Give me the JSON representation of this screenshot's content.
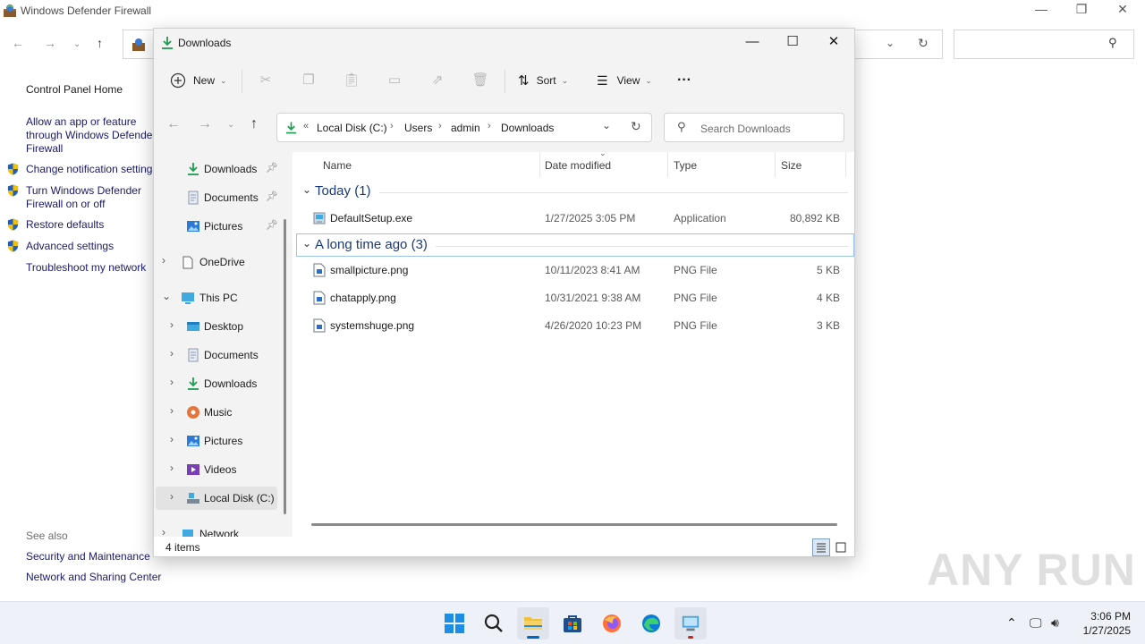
{
  "firewall": {
    "title": "Windows Defender Firewall",
    "minimize": "—",
    "maximize": "❐",
    "close": "✕",
    "sidebar": {
      "home": "Control Panel Home",
      "allow_app_line1": "Allow an app or feature",
      "allow_app_line2": "through Windows Defender",
      "allow_app_line3": "Firewall",
      "change_notification": "Change notification settings",
      "turn_on_off_line1": "Turn Windows Defender",
      "turn_on_off_line2": "Firewall on or off",
      "restore_defaults": "Restore defaults",
      "advanced_settings": "Advanced settings",
      "troubleshoot": "Troubleshoot my network"
    },
    "see_also": {
      "heading": "See also",
      "security_maintenance": "Security and Maintenance",
      "network_sharing": "Network and Sharing Center"
    }
  },
  "explorer": {
    "title": "Downloads",
    "toolbar": {
      "new_label": "New",
      "sort_label": "Sort",
      "view_label": "View",
      "more_label": "···"
    },
    "breadcrumb": {
      "overflow": "«",
      "items": [
        "Local Disk (C:)",
        "Users",
        "admin",
        "Downloads"
      ]
    },
    "search_placeholder": "Search Downloads",
    "nav": {
      "quick": [
        {
          "label": "Downloads",
          "pinned": true
        },
        {
          "label": "Documents",
          "pinned": true
        },
        {
          "label": "Pictures",
          "pinned": true
        }
      ],
      "onedrive": "OneDrive",
      "this_pc": "This PC",
      "pc_items": [
        "Desktop",
        "Documents",
        "Downloads",
        "Music",
        "Pictures",
        "Videos",
        "Local Disk (C:)"
      ],
      "network": "Network"
    },
    "columns": {
      "name": "Name",
      "date": "Date modified",
      "type": "Type",
      "size": "Size"
    },
    "groups": [
      {
        "label": "Today (1)",
        "files": [
          {
            "name": "DefaultSetup.exe",
            "date": "1/27/2025 3:05 PM",
            "type": "Application",
            "size": "80,892 KB",
            "kind": "exe"
          }
        ]
      },
      {
        "label": "A long time ago (3)",
        "files": [
          {
            "name": "smallpicture.png",
            "date": "10/11/2023 8:41 AM",
            "type": "PNG File",
            "size": "5 KB",
            "kind": "png"
          },
          {
            "name": "chatapply.png",
            "date": "10/31/2021 9:38 AM",
            "type": "PNG File",
            "size": "4 KB",
            "kind": "png"
          },
          {
            "name": "systemshuge.png",
            "date": "4/26/2020 10:23 PM",
            "type": "PNG File",
            "size": "3 KB",
            "kind": "png"
          }
        ]
      }
    ],
    "status_count": "4 items"
  },
  "taskbar": {
    "time": "3:06 PM",
    "date": "1/27/2025",
    "apps": [
      "start-icon",
      "search-icon",
      "file-explorer-icon",
      "store-icon",
      "firefox-icon",
      "edge-icon",
      "control-panel-icon"
    ]
  },
  "watermark": "ANY RUN",
  "colors": {
    "accent": "#0067c0",
    "folder_yellow": "#f0c23c",
    "download_green": "#1e9c4f",
    "shield_blue": "#1f5fbf",
    "shield_yellow": "#f2c200"
  }
}
